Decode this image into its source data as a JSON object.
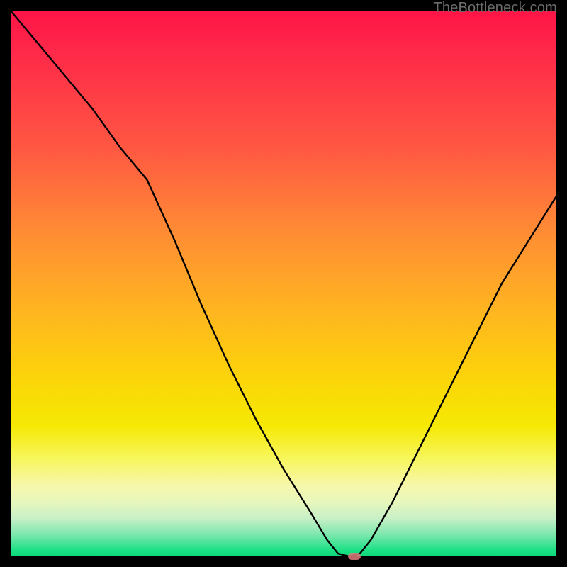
{
  "watermark": "TheBottleneck.com",
  "colors": {
    "frame": "#000000",
    "curve": "#000000",
    "marker": "#e17a7b",
    "gradient_top": "#ff1447",
    "gradient_mid1": "#ff8a35",
    "gradient_mid2": "#fbd608",
    "gradient_bottom": "#0dd879"
  },
  "chart_data": {
    "type": "line",
    "title": "",
    "xlabel": "",
    "ylabel": "",
    "xlim": [
      0,
      100
    ],
    "ylim": [
      0,
      100
    ],
    "grid": false,
    "legend": false,
    "description": "Bottleneck percentage curve. Valley near x≈63 indicates minimal bottleneck (good/green). High values (red) at extremes indicate heavy bottleneck.",
    "series": [
      {
        "name": "bottleneck-curve",
        "x": [
          0,
          5,
          10,
          15,
          20,
          25,
          30,
          35,
          40,
          45,
          50,
          55,
          58,
          60,
          62,
          64,
          66,
          70,
          75,
          80,
          85,
          90,
          95,
          100
        ],
        "y": [
          100,
          94,
          88,
          82,
          75,
          69,
          58,
          46,
          35,
          25,
          16,
          8,
          3,
          0.5,
          0,
          0.5,
          3,
          10,
          20,
          30,
          40,
          50,
          58,
          66
        ]
      }
    ],
    "marker": {
      "x": 63,
      "y": 0,
      "label": "optimal-point"
    },
    "background_gradient": {
      "orientation": "vertical",
      "meaning": "bottleneck severity (red=high at top, green=low at bottom)",
      "stops": [
        {
          "pos": 0.0,
          "color": "#ff1447"
        },
        {
          "pos": 0.25,
          "color": "#ff5742"
        },
        {
          "pos": 0.55,
          "color": "#ffb520"
        },
        {
          "pos": 0.76,
          "color": "#f6e904"
        },
        {
          "pos": 0.93,
          "color": "#c8f0c7"
        },
        {
          "pos": 1.0,
          "color": "#0dd879"
        }
      ]
    }
  }
}
